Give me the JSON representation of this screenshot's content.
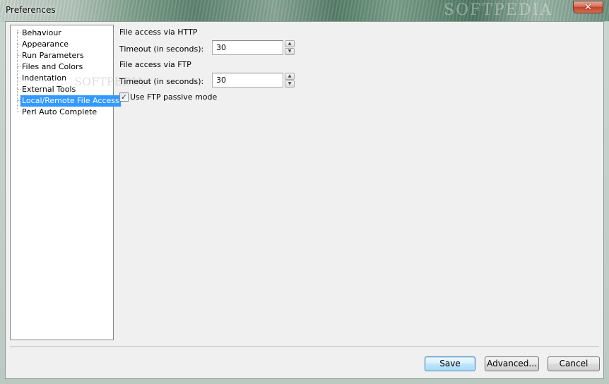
{
  "window": {
    "title": "Preferences",
    "watermark": "SOFTPEDIA",
    "close_glyph": "✕"
  },
  "tree": {
    "items": [
      {
        "label": "Behaviour",
        "selected": false
      },
      {
        "label": "Appearance",
        "selected": false
      },
      {
        "label": "Run Parameters",
        "selected": false
      },
      {
        "label": "Files and Colors",
        "selected": false
      },
      {
        "label": "Indentation",
        "selected": false
      },
      {
        "label": "External Tools",
        "selected": false
      },
      {
        "label": "Local/Remote File Access",
        "selected": true
      },
      {
        "label": "Perl Auto Complete",
        "selected": false
      }
    ],
    "watermark": "SOFTPEDIA"
  },
  "http": {
    "section_label": "File access via HTTP",
    "timeout_label": "Timeout (in seconds):",
    "timeout_value": "30"
  },
  "ftp": {
    "section_label": "File access via FTP",
    "timeout_label": "Timeout (in seconds):",
    "timeout_value": "30",
    "passive_label": "Use FTP passive mode",
    "passive_checked": true
  },
  "buttons": {
    "save": "Save",
    "advanced": "Advanced...",
    "cancel": "Cancel"
  },
  "icons": {
    "spin_up": "▲",
    "spin_down": "▼",
    "check": "✓"
  }
}
